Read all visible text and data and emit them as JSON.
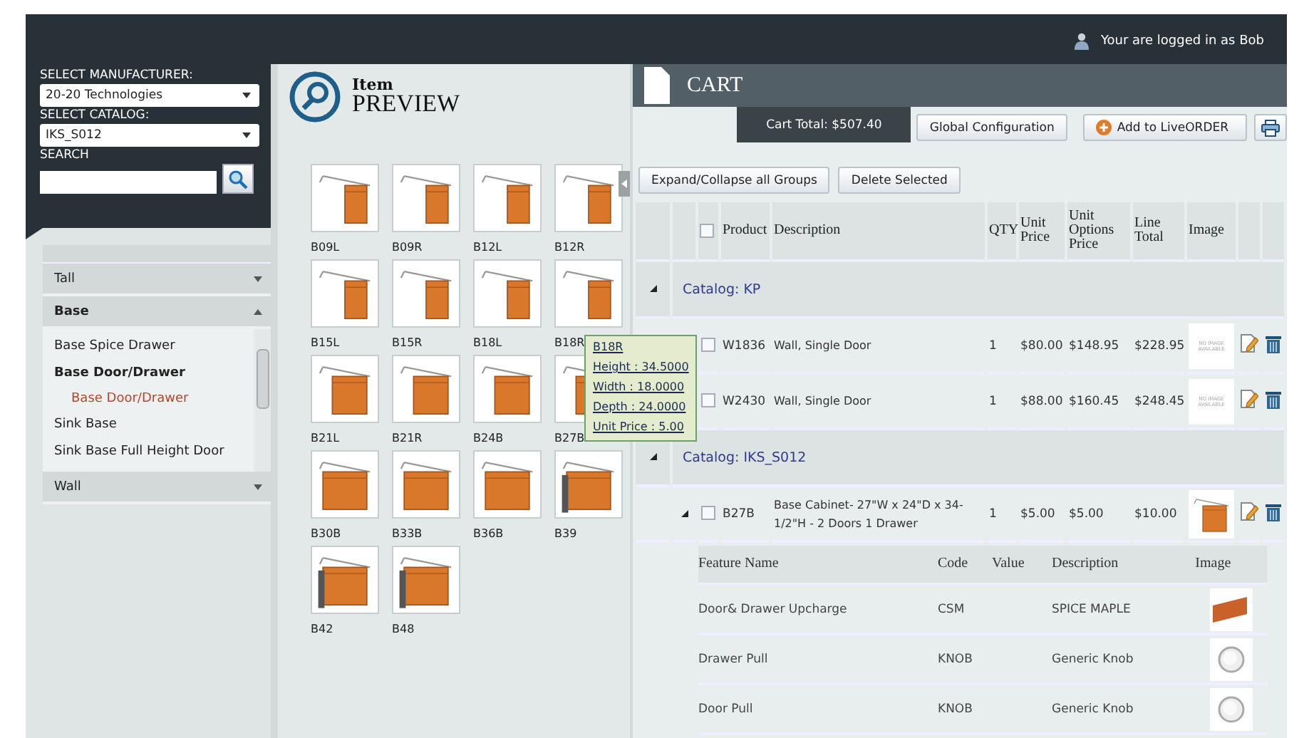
{
  "header": {
    "user_text": "Your are logged in as Bob"
  },
  "sidebar": {
    "manufacturer_label": "SELECT MANUFACTURER:",
    "manufacturer_value": "20-20 Technologies",
    "catalog_label": "SELECT CATALOG:",
    "catalog_value": "IKS_S012",
    "search_label": "SEARCH",
    "categories": [
      {
        "label": "Tall",
        "expanded": false
      },
      {
        "label": "Base",
        "expanded": true,
        "items": [
          {
            "label": "Base Spice Drawer",
            "expanded": false
          },
          {
            "label": "Base Door/Drawer",
            "expanded": true,
            "children": [
              {
                "label": "Base Door/Drawer",
                "selected": true
              }
            ]
          },
          {
            "label": "Sink Base",
            "expanded": false
          },
          {
            "label": "Sink Base Full Height Door",
            "expanded": false
          }
        ]
      },
      {
        "label": "Wall",
        "expanded": false
      }
    ]
  },
  "preview": {
    "title_small": "Item",
    "title_big": "PREVIEW",
    "items": [
      {
        "code": "B09L",
        "kind": "narrow"
      },
      {
        "code": "B09R",
        "kind": "narrow"
      },
      {
        "code": "B12L",
        "kind": "narrow"
      },
      {
        "code": "B12R",
        "kind": "narrow"
      },
      {
        "code": "B15L",
        "kind": "narrow"
      },
      {
        "code": "B15R",
        "kind": "narrow"
      },
      {
        "code": "B18L",
        "kind": "narrow"
      },
      {
        "code": "B18R",
        "kind": "narrow"
      },
      {
        "code": "B21L",
        "kind": "medium"
      },
      {
        "code": "B21R",
        "kind": "medium"
      },
      {
        "code": "B24B",
        "kind": "medium"
      },
      {
        "code": "B27B",
        "kind": "medium"
      },
      {
        "code": "B30B",
        "kind": "wide"
      },
      {
        "code": "B33B",
        "kind": "wide"
      },
      {
        "code": "B36B",
        "kind": "wide"
      },
      {
        "code": "B39",
        "kind": "end-panel"
      },
      {
        "code": "B42",
        "kind": "end-panel"
      },
      {
        "code": "B48",
        "kind": "end-panel"
      }
    ],
    "tooltip": {
      "lines": [
        "B18R",
        "Height : 34.5000",
        "Width : 18.0000",
        "Depth : 24.0000",
        "Unit Price : 5.00"
      ]
    }
  },
  "cart": {
    "title": "CART",
    "total": "Cart Total: $507.40",
    "buttons": [
      "Global Configuration",
      "Add to LiveORDER"
    ],
    "actions": [
      "Expand/Collapse all Groups",
      "Delete Selected"
    ],
    "select_all_checked": false,
    "columns": [
      "Product",
      "Description",
      "QTY",
      "Unit Price",
      "Unit Options Price",
      "Line Total",
      "Image"
    ],
    "groups": [
      {
        "label": "Catalog: KP",
        "expanded": true,
        "items": [
          {
            "product": "W1836",
            "description": "Wall, Single Door",
            "qty": "1",
            "unit_price": "$80.00",
            "options_price": "$148.95",
            "line_total": "$228.95",
            "checked": false,
            "kind": "none",
            "image_text": "NO IMAGE AVAILABLE"
          },
          {
            "product": "W2430",
            "description": "Wall, Single Door",
            "qty": "1",
            "unit_price": "$88.00",
            "options_price": "$160.45",
            "line_total": "$248.45",
            "checked": false,
            "kind": "none",
            "image_text": "NO IMAGE AVAILABLE"
          }
        ]
      },
      {
        "label": "Catalog: IKS_S012",
        "expanded": true,
        "items": [
          {
            "product": "B27B",
            "description": "Base Cabinet- 27\"W x 24\"D x 34-1/2\"H - 2 Doors 1 Drawer",
            "qty": "1",
            "unit_price": "$5.00",
            "options_price": "$5.00",
            "line_total": "$10.00",
            "checked": false,
            "kind": "cabinet",
            "expanded": true,
            "features": {
              "columns": [
                "Feature Name",
                "Code",
                "Value",
                "Description",
                "Image"
              ],
              "rows": [
                {
                  "name": "Door& Drawer Upcharge",
                  "code": "CSM",
                  "description": "SPICE MAPLE",
                  "kind": "swatch"
                },
                {
                  "name": "Drawer Pull",
                  "code": "KNOB",
                  "description": "Generic Knob",
                  "kind": "knob"
                },
                {
                  "name": "Door Pull",
                  "code": "KNOB",
                  "description": "Generic Knob",
                  "kind": "knob"
                }
              ]
            }
          }
        ]
      }
    ]
  }
}
